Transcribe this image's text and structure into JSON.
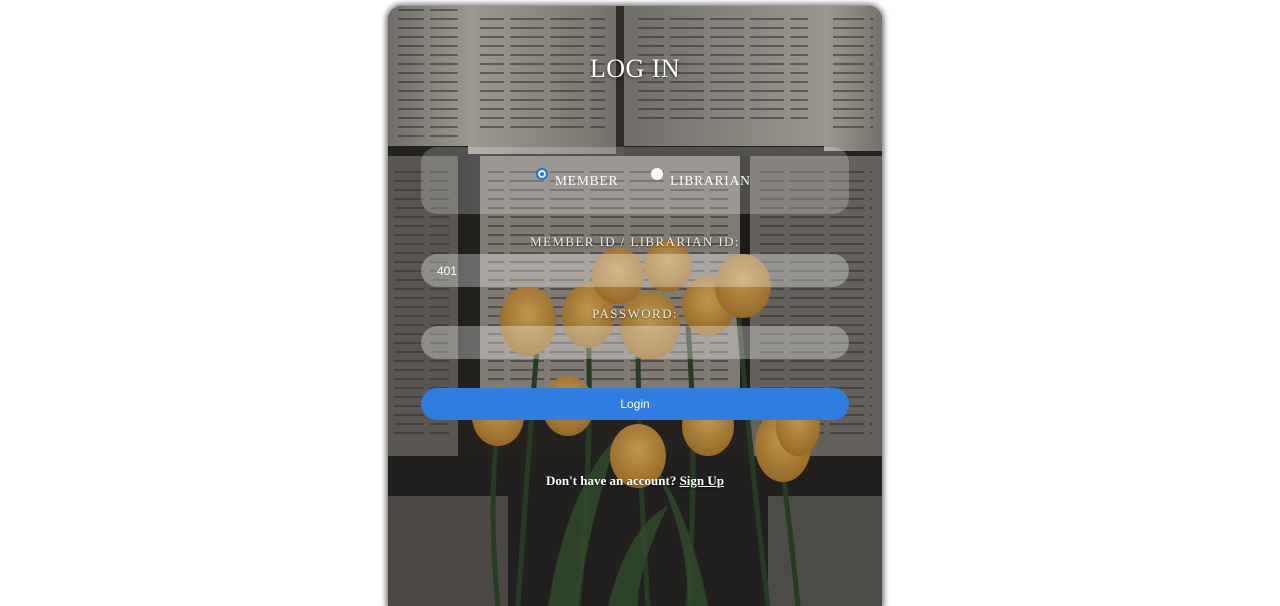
{
  "login": {
    "title": "LOG IN",
    "roles": [
      {
        "label": "MEMBER",
        "selected": true
      },
      {
        "label": "LIBRARIAN",
        "selected": false
      }
    ],
    "id_label": "MEMBER ID / LIBRARIAN ID:",
    "id_value": "401",
    "password_label": "PASSWORD:",
    "password_value": "",
    "login_button": "Login",
    "signup_prompt": "Don't have an account?",
    "signup_link": "Sign Up"
  },
  "colors": {
    "accent": "#2f7de1",
    "radio_checked": "#1a73e8"
  },
  "background_image": "books-and-yellow-tulips"
}
